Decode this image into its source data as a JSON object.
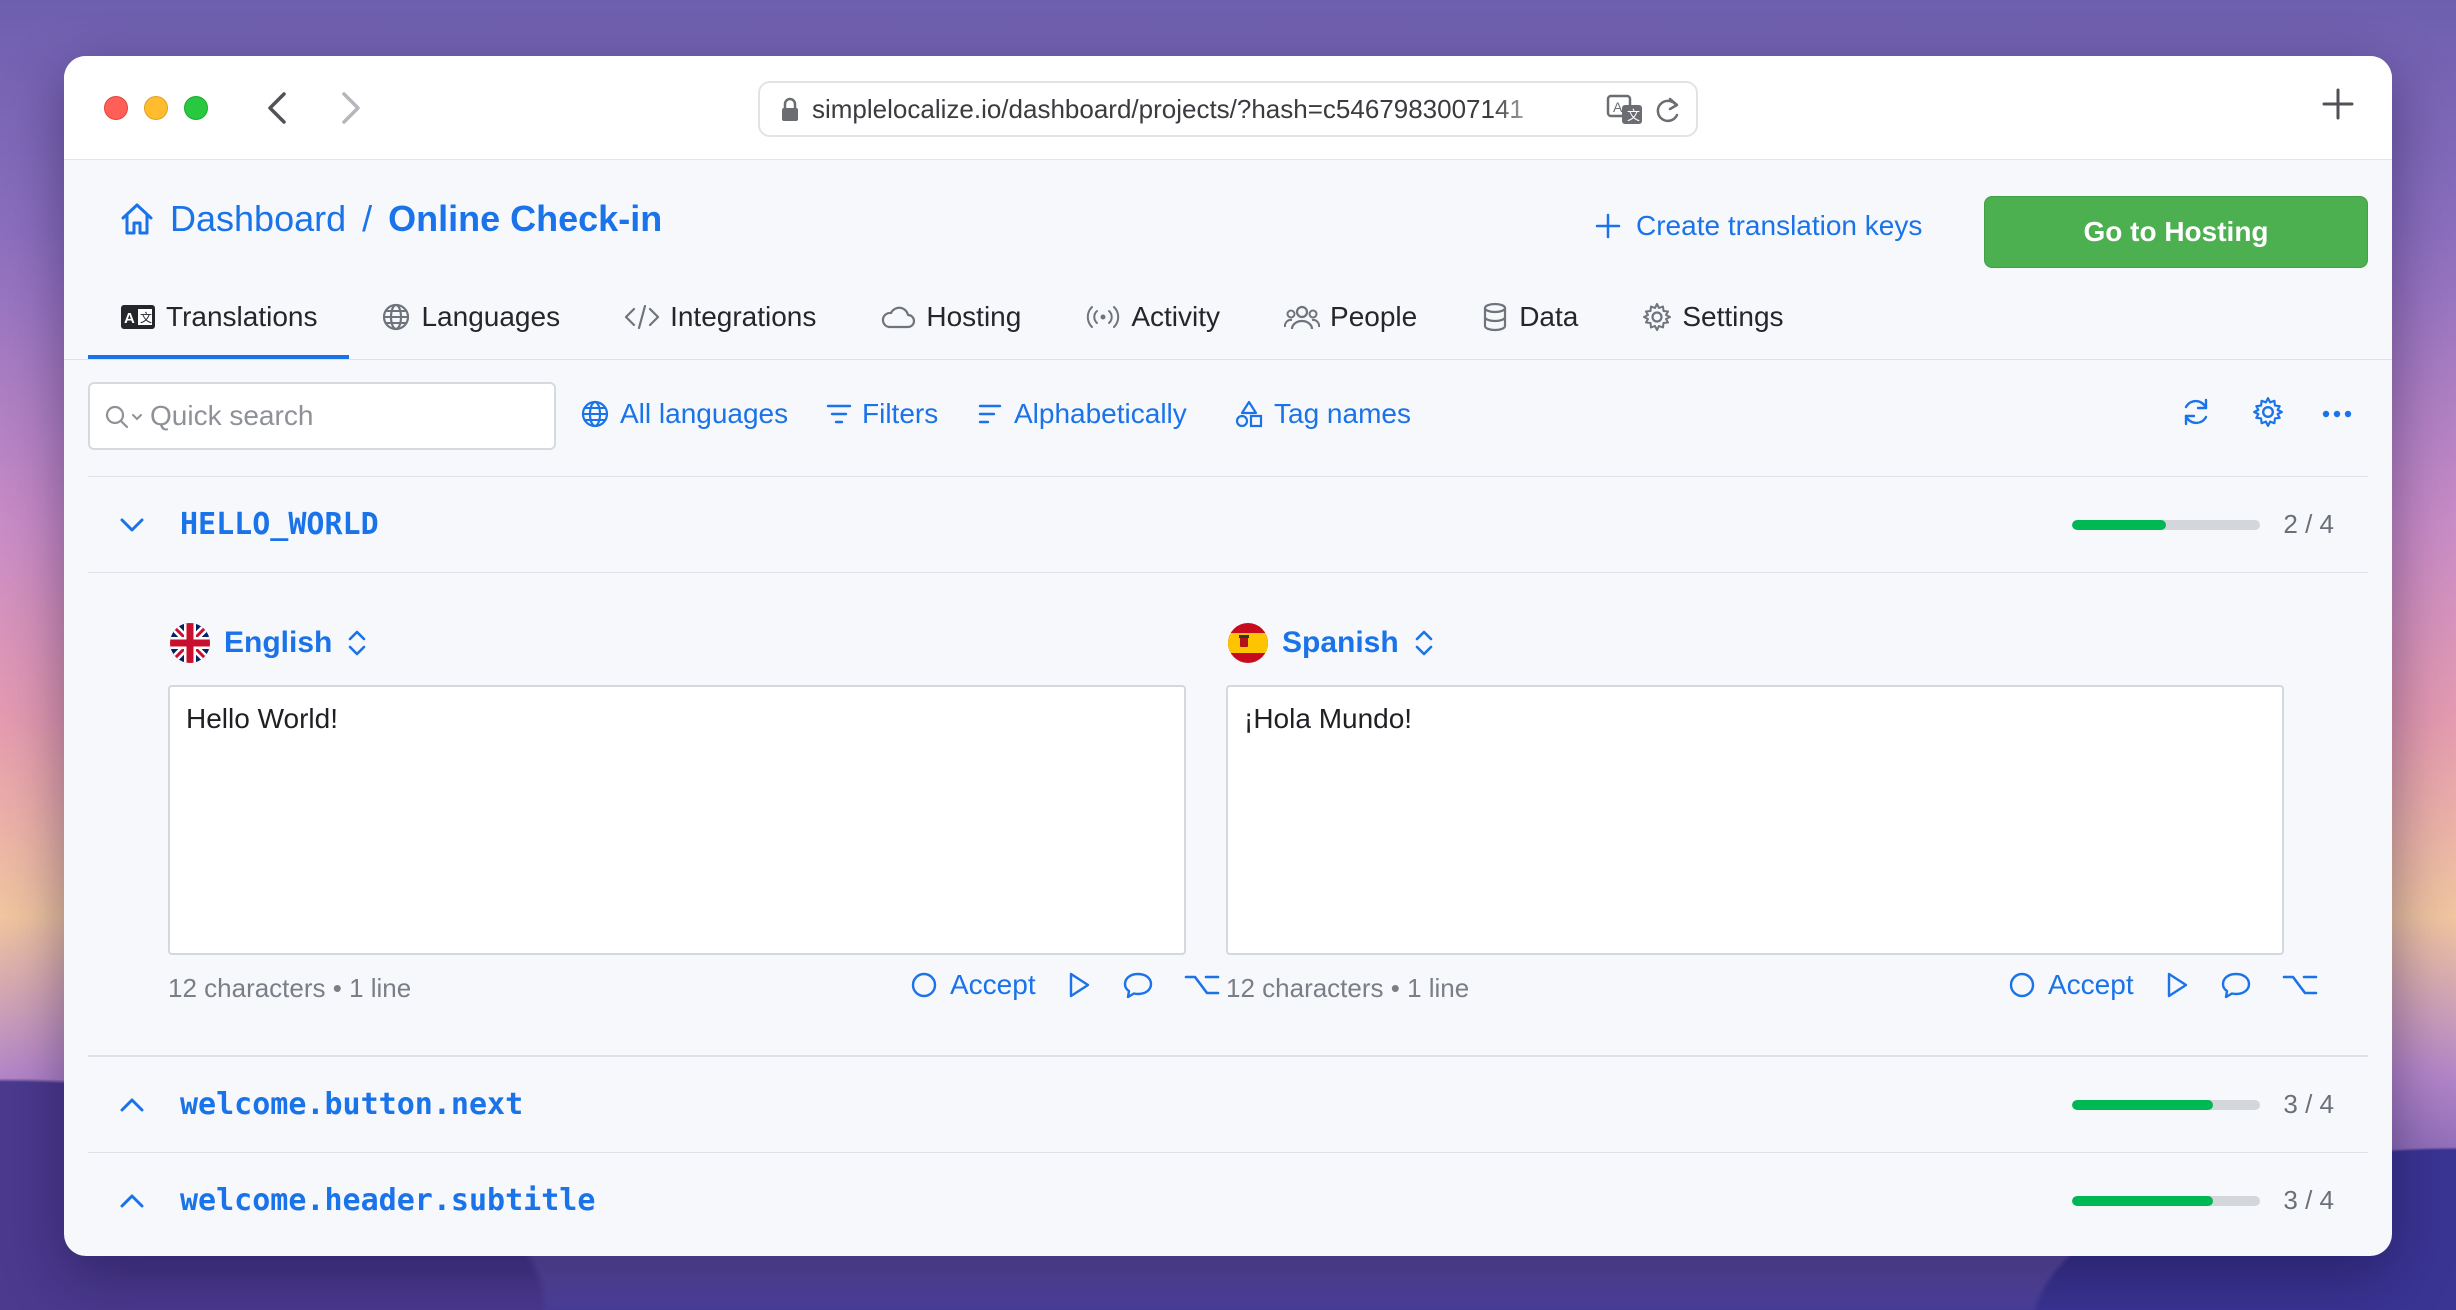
{
  "browser": {
    "url": "simplelocalize.io/dashboard/projects/?hash=c5467983007141"
  },
  "header": {
    "breadcrumb_root": "Dashboard",
    "breadcrumb_sep": "/",
    "project_name": "Online Check-in",
    "create_keys_label": "Create translation keys",
    "hosting_button_label": "Go to Hosting"
  },
  "tabs": [
    {
      "label": "Translations",
      "icon": "translations-icon",
      "active": true
    },
    {
      "label": "Languages",
      "icon": "globe-icon"
    },
    {
      "label": "Integrations",
      "icon": "code-icon"
    },
    {
      "label": "Hosting",
      "icon": "cloud-icon"
    },
    {
      "label": "Activity",
      "icon": "broadcast-icon"
    },
    {
      "label": "People",
      "icon": "people-icon"
    },
    {
      "label": "Data",
      "icon": "database-icon"
    },
    {
      "label": "Settings",
      "icon": "gear-icon"
    }
  ],
  "toolbar": {
    "search_placeholder": "Quick search",
    "languages_label": "All languages",
    "filters_label": "Filters",
    "sort_label": "Alphabetically",
    "tags_label": "Tag names"
  },
  "keys": [
    {
      "name": "HELLO_WORLD",
      "expanded": true,
      "progress": 0.5,
      "count": "2 / 4",
      "translations": [
        {
          "language": "English",
          "text": "Hello World!",
          "meta": "12 characters • 1 line",
          "accept_label": "Accept"
        },
        {
          "language": "Spanish",
          "text": "¡Hola Mundo!",
          "meta": "12 characters • 1 line",
          "accept_label": "Accept"
        }
      ]
    },
    {
      "name": "welcome.button.next",
      "expanded": false,
      "progress": 0.75,
      "count": "3 / 4"
    },
    {
      "name": "welcome.header.subtitle",
      "expanded": false,
      "progress": 0.75,
      "count": "3 / 4"
    }
  ],
  "colors": {
    "accent": "#1a73e8",
    "primary_button": "#4caf50",
    "progress_fill": "#00b853"
  }
}
